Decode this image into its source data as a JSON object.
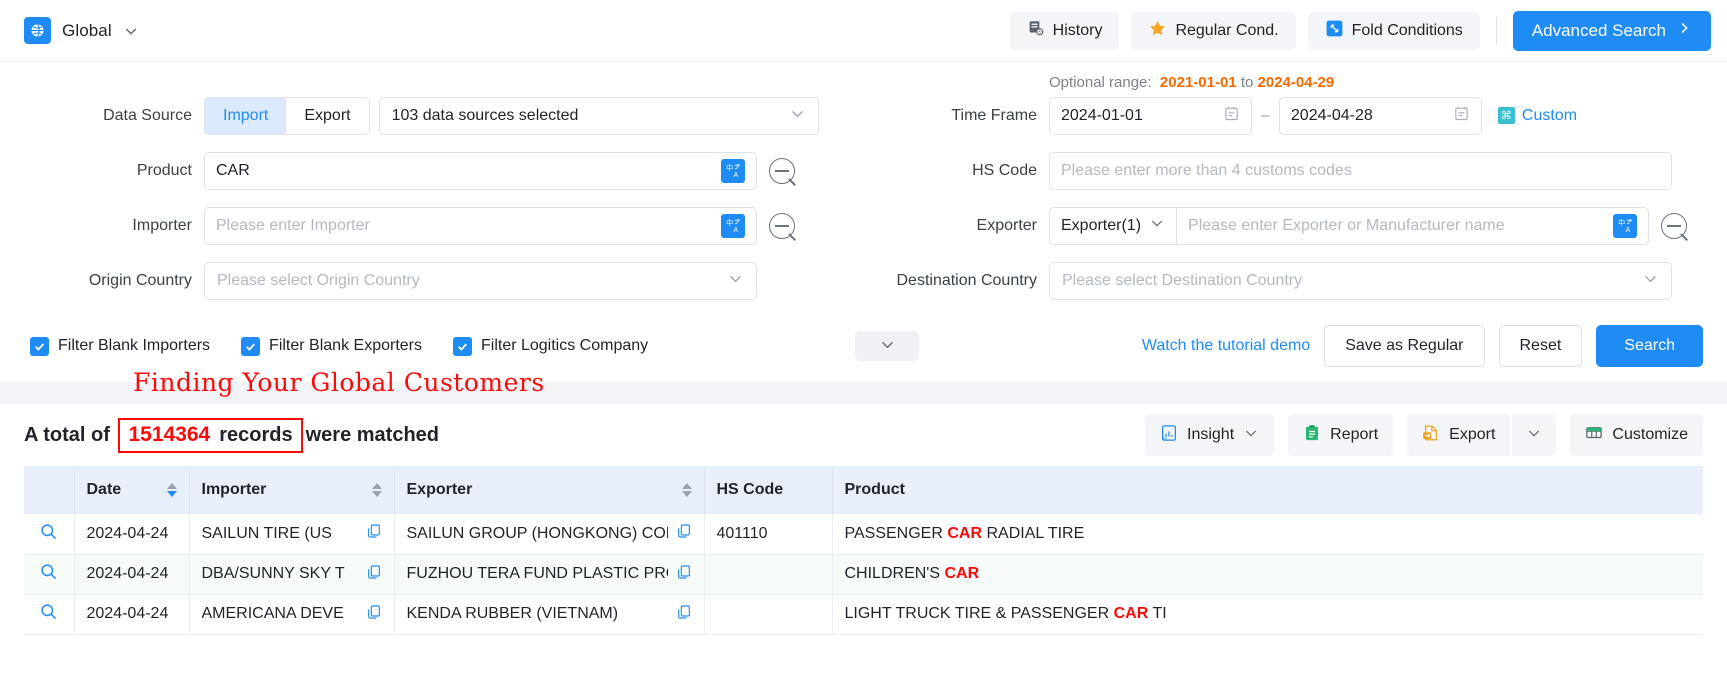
{
  "topbar": {
    "region_label": "Global",
    "buttons": [
      {
        "label": "History",
        "icon": "history-list-icon"
      },
      {
        "label": "Regular Cond.",
        "icon": "star-icon"
      },
      {
        "label": "Fold Conditions",
        "icon": "fold-arrows-icon"
      }
    ],
    "advanced_search_label": "Advanced Search"
  },
  "form": {
    "data_source": {
      "label": "Data Source",
      "segments": [
        {
          "label": "Import",
          "active": true
        },
        {
          "label": "Export",
          "active": false
        }
      ],
      "select_value": "103 data sources selected"
    },
    "product": {
      "label": "Product",
      "value": "CAR",
      "placeholder": ""
    },
    "importer": {
      "label": "Importer",
      "value": "",
      "placeholder": "Please enter Importer"
    },
    "origin_country": {
      "label": "Origin Country",
      "placeholder": "Please select Origin Country"
    },
    "optional_range": {
      "prefix": "Optional range:",
      "start": "2021-01-01",
      "middle": "to",
      "end": "2024-04-29"
    },
    "time_frame": {
      "label": "Time Frame",
      "start": "2024-01-01",
      "end": "2024-04-28",
      "separator": "–",
      "custom_label": "Custom"
    },
    "hs_code": {
      "label": "HS Code",
      "value": "",
      "placeholder": "Please enter more than 4 customs codes"
    },
    "exporter": {
      "label": "Exporter",
      "mode": "Exporter(1)",
      "value": "",
      "placeholder": "Please enter Exporter or Manufacturer name"
    },
    "destination_country": {
      "label": "Destination Country",
      "placeholder": "Please select Destination Country"
    },
    "checkboxes": [
      {
        "label": "Filter Blank Importers",
        "checked": true
      },
      {
        "label": "Filter Blank Exporters",
        "checked": true
      },
      {
        "label": "Filter Logitics Company",
        "checked": true
      }
    ],
    "tutorial_link": "Watch the tutorial demo",
    "save_regular_label": "Save as Regular",
    "reset_label": "Reset",
    "search_label": "Search"
  },
  "annotation": {
    "headline": "Finding Your Global Customers",
    "color": "#fb0a0a"
  },
  "results": {
    "total_prefix": "A total of",
    "total_count": "1514364",
    "total_unit": "records",
    "total_suffix": "were matched",
    "tools": [
      {
        "label": "Insight",
        "icon": "bi-insight-icon",
        "has_caret": true
      },
      {
        "label": "Report",
        "icon": "report-clipboard-icon",
        "has_caret": false
      },
      {
        "label": "Export",
        "icon": "export-doc-icon",
        "has_caret": false
      },
      {
        "label": "Customize",
        "icon": "table-columns-icon",
        "has_caret": false
      }
    ],
    "export_caret": true,
    "table": {
      "columns": [
        {
          "key": "action",
          "label": "",
          "sortable": false
        },
        {
          "key": "date",
          "label": "Date",
          "sortable": true,
          "sort": "desc"
        },
        {
          "key": "importer",
          "label": "Importer",
          "sortable": true,
          "sort": "none"
        },
        {
          "key": "exporter",
          "label": "Exporter",
          "sortable": true,
          "sort": "none"
        },
        {
          "key": "hs_code",
          "label": "HS Code",
          "sortable": false
        },
        {
          "key": "product",
          "label": "Product",
          "sortable": false
        }
      ],
      "rows": [
        {
          "date": "2024-04-24",
          "importer": "SAILUN TIRE (US",
          "exporter": "SAILUN GROUP (HONGKONG) COM",
          "hs_code": "401110",
          "product_pre": "PASSENGER ",
          "product_hl": "CAR",
          "product_post": " RADIAL TIRE"
        },
        {
          "date": "2024-04-24",
          "importer": "DBA/SUNNY SKY T",
          "exporter": "FUZHOU TERA FUND PLASTIC PRO",
          "hs_code": "",
          "product_pre": "CHILDREN'S ",
          "product_hl": "CAR",
          "product_post": ""
        },
        {
          "date": "2024-04-24",
          "importer": "AMERICANA DEVE",
          "exporter": "KENDA RUBBER (VIETNAM)",
          "hs_code": "",
          "product_pre": "LIGHT TRUCK TIRE & PASSENGER ",
          "product_hl": "CAR",
          "product_post": " TI"
        }
      ]
    }
  },
  "colors": {
    "accent_blue": "#1f8cf5",
    "highlight_red": "#fb0a0a",
    "range_orange": "#f56a00",
    "table_header_bg": "#e9eefb",
    "alt_row_bg": "#f7fbf8"
  }
}
